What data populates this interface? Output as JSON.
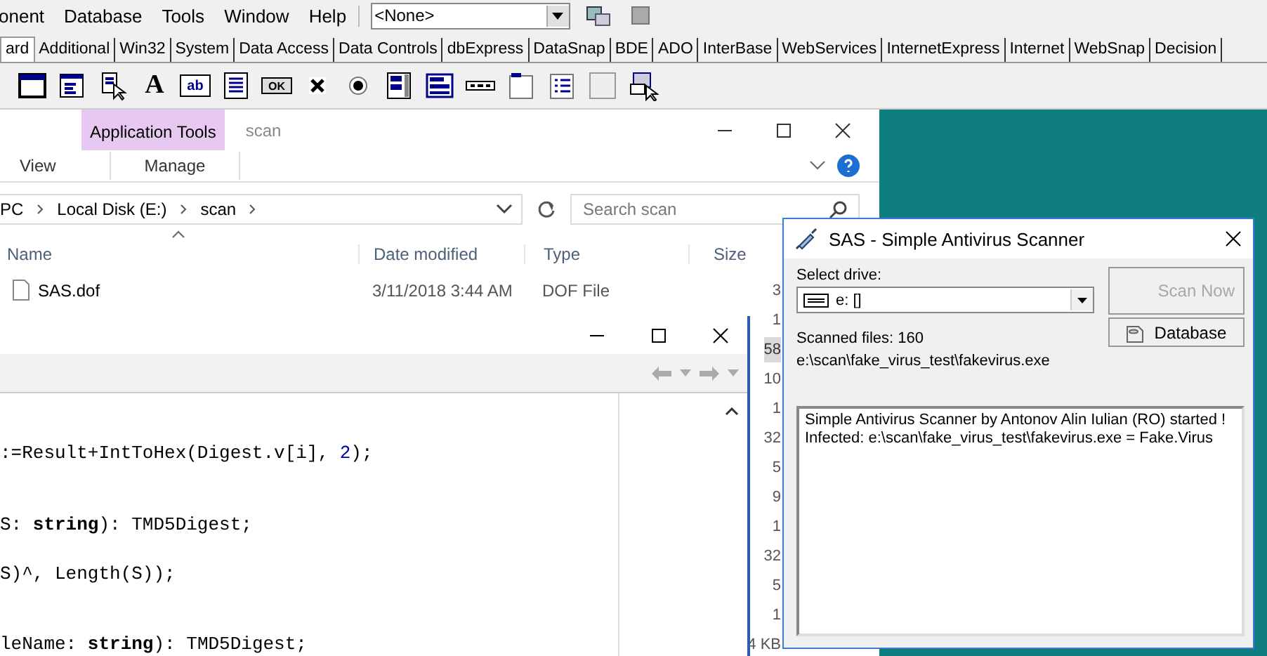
{
  "ide": {
    "menu": [
      "onent",
      "Database",
      "Tools",
      "Window",
      "Help"
    ],
    "component_combo": {
      "value": "<None>"
    },
    "palette_tabs": [
      {
        "label": "ard",
        "selected": true
      },
      {
        "label": "Additional",
        "selected": false
      },
      {
        "label": "Win32",
        "selected": false
      },
      {
        "label": "System",
        "selected": false
      },
      {
        "label": "Data Access",
        "selected": false
      },
      {
        "label": "Data Controls",
        "selected": false
      },
      {
        "label": "dbExpress",
        "selected": false
      },
      {
        "label": "DataSnap",
        "selected": false
      },
      {
        "label": "BDE",
        "selected": false
      },
      {
        "label": "ADO",
        "selected": false
      },
      {
        "label": "InterBase",
        "selected": false
      },
      {
        "label": "WebServices",
        "selected": false
      },
      {
        "label": "InternetExpress",
        "selected": false
      },
      {
        "label": "Internet",
        "selected": false
      },
      {
        "label": "WebSnap",
        "selected": false
      },
      {
        "label": "Decision",
        "selected": false
      }
    ],
    "palette": [
      {
        "kind": "form"
      },
      {
        "kind": "menu"
      },
      {
        "kind": "popup"
      },
      {
        "kind": "label",
        "glyph": "A"
      },
      {
        "kind": "edit",
        "glyph": "ab"
      },
      {
        "kind": "memo"
      },
      {
        "kind": "button",
        "glyph": "OK"
      },
      {
        "kind": "checkbox"
      },
      {
        "kind": "radio"
      },
      {
        "kind": "listbox"
      },
      {
        "kind": "combobox"
      },
      {
        "kind": "scrollbar"
      },
      {
        "kind": "groupbox"
      },
      {
        "kind": "radiogroup"
      },
      {
        "kind": "panel"
      },
      {
        "kind": "actionlist"
      }
    ]
  },
  "explorer": {
    "context_group": "Application Tools",
    "title": "scan",
    "ribbon_tabs": [
      "View",
      "Manage"
    ],
    "address": [
      "PC",
      "Local Disk (E:)",
      "scan"
    ],
    "search": {
      "placeholder": "Search scan"
    },
    "columns": [
      "Name",
      "Date modified",
      "Type",
      "Size"
    ],
    "files": [
      {
        "name": "SAS.dof",
        "date": "3/11/2018 3:44 AM",
        "type": "DOF File",
        "size": "3",
        "selected": false
      },
      {
        "size": "1",
        "selected": false
      },
      {
        "size": "58",
        "selected": true
      },
      {
        "size": "10",
        "selected": false
      },
      {
        "size": "1",
        "selected": false
      },
      {
        "size": "32",
        "selected": false
      },
      {
        "size": "5",
        "selected": false
      },
      {
        "size": "9",
        "selected": false
      },
      {
        "size": "1",
        "selected": false
      },
      {
        "size": "32",
        "selected": false
      },
      {
        "size": "5",
        "selected": false
      },
      {
        "size": "1",
        "selected": false
      },
      {
        "size": "4 KB",
        "selected": false
      }
    ]
  },
  "editor": {
    "code_lines": [
      [
        {
          "text": ":=Result+IntToHex(Digest.v[i], ",
          "kind": "plain"
        },
        {
          "text": "2",
          "kind": "number"
        },
        {
          "text": ");",
          "kind": "plain"
        }
      ],
      [
        {
          "text": "S: ",
          "kind": "plain"
        },
        {
          "text": "string",
          "kind": "keyword"
        },
        {
          "text": "): TMD5Digest;",
          "kind": "plain"
        }
      ],
      [
        {
          "text": "S)^, Length(S));",
          "kind": "plain"
        }
      ],
      [
        {
          "text": "leName: ",
          "kind": "plain"
        },
        {
          "text": "string",
          "kind": "keyword"
        },
        {
          "text": "): TMD5Digest;",
          "kind": "plain"
        }
      ]
    ]
  },
  "sas": {
    "title": "SAS - Simple Antivirus Scanner",
    "drive_label": "Select drive:",
    "drive": {
      "value": "e: []"
    },
    "scan_button": {
      "label": "Scan Now",
      "disabled": true
    },
    "database_button": {
      "label": "Database",
      "disabled": false
    },
    "scanned_files": "Scanned files: 160",
    "current_file": "e:\\scan\\fake_virus_test\\fakevirus.exe",
    "log": [
      "Simple Antivirus Scanner by Antonov Alin Iulian (RO) started !",
      "Infected: e:\\scan\\fake_virus_test\\fakevirus.exe = Fake.Virus"
    ]
  }
}
